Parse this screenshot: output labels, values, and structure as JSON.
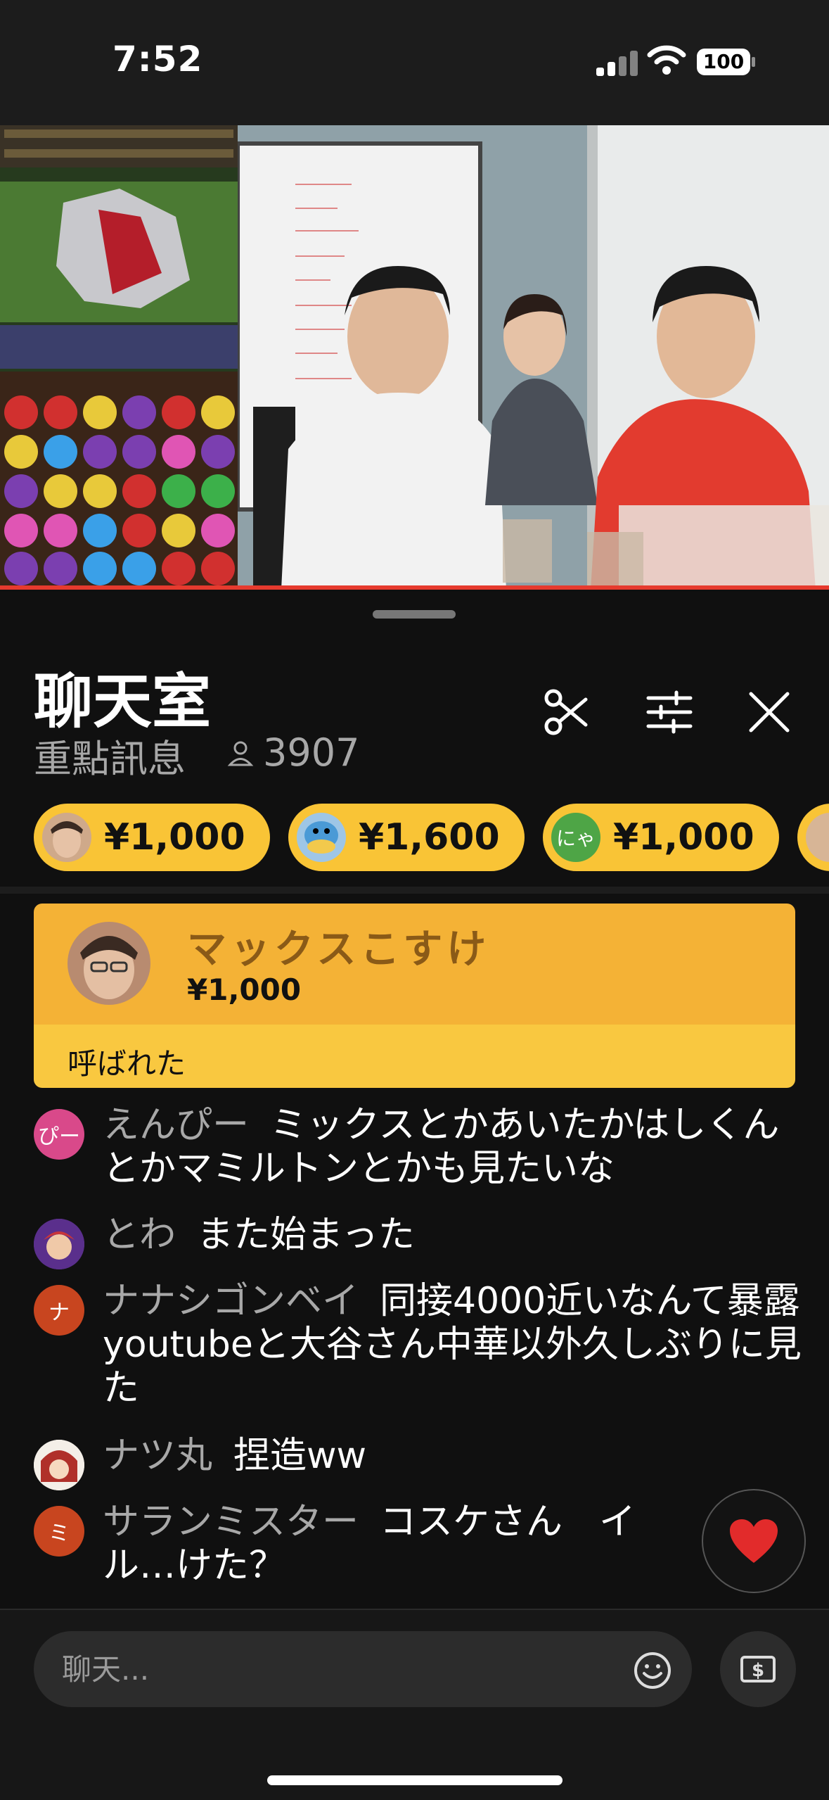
{
  "status": {
    "time": "7:52",
    "battery": "100"
  },
  "chat": {
    "title": "聊天室",
    "mode": "重點訊息",
    "viewer_count": "3907"
  },
  "superchat_chips": [
    {
      "amount": "¥1,000",
      "avatar": "face-avatar"
    },
    {
      "amount": "¥1,600",
      "avatar": "bird-avatar"
    },
    {
      "amount": "¥1,000",
      "avatar": "nya-avatar",
      "avatar_text": "にゃ"
    }
  ],
  "pinned": {
    "name": "マックスこすけ",
    "amount": "¥1,000",
    "message": "呼ばれた"
  },
  "messages": [
    {
      "avatar_text": "ぴー",
      "avatar_color": "#d9498a",
      "author": "えんぴー",
      "text": "ミックスとかあいたかはしくんとかマミルトンとかも見たいな"
    },
    {
      "avatar_text": "",
      "avatar_color": "#6b3fa0",
      "author": "とわ",
      "text": "また始まった"
    },
    {
      "avatar_text": "ナ",
      "avatar_color": "#c8451f",
      "author": "ナナシゴンベイ",
      "text": "同接4000近いなんて暴露youtubeと大谷さん中華以外久しぶりに見た"
    },
    {
      "avatar_text": "",
      "avatar_color": "#e2dbd0",
      "author": "ナツ丸",
      "text": "捏造ww"
    },
    {
      "avatar_text": "ミ",
      "avatar_color": "#c8451f",
      "author": "サランミスター",
      "text": "コスケさん　イル…けた？"
    }
  ],
  "input": {
    "placeholder": "聊天..."
  },
  "colors": {
    "superchat": "#f4b236",
    "superchat_light": "#f9c840",
    "accent_red": "#e63a2e"
  }
}
